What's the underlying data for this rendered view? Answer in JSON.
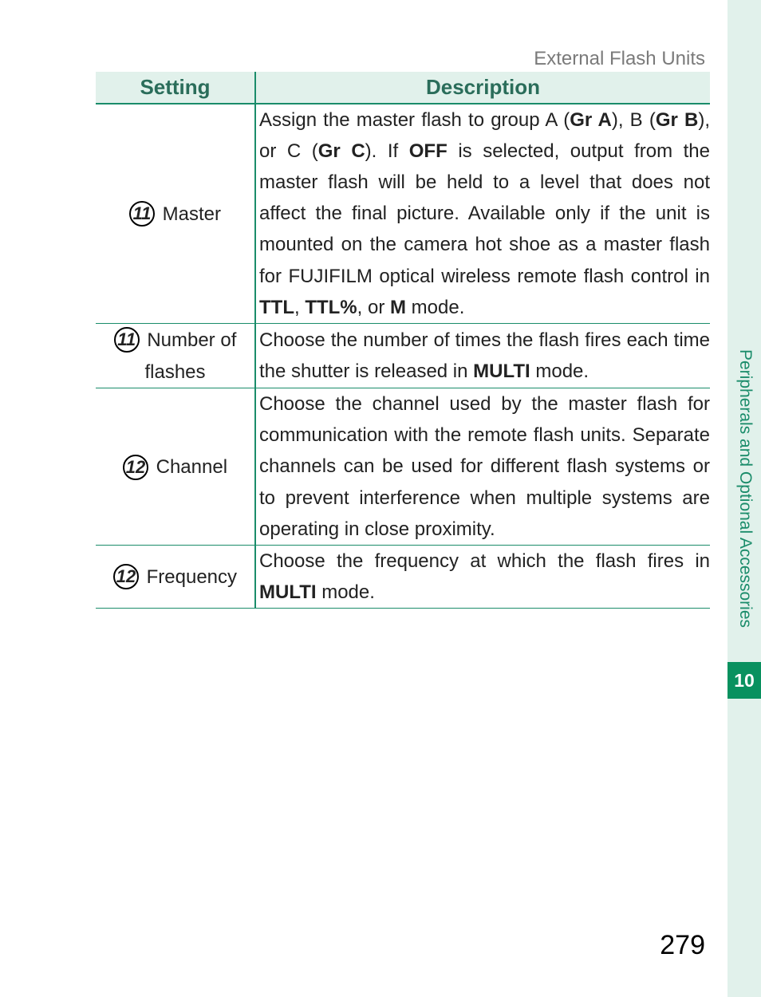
{
  "section_title": "External Flash Units",
  "headers": {
    "setting": "Setting",
    "description": "Description"
  },
  "rows": [
    {
      "num": "11",
      "label": "Master",
      "desc_html": "Assign the master flash to group A (<b>Gr A</b>), B (<b>Gr B</b>), or C (<b>Gr C</b>). If <b>OFF</b> is selected, output from the master flash will be held to a level that does not affect the final picture. Available only if the unit is mounted on the camera hot shoe as a master flash for FUJIFILM optical wireless remote flash control in <b>TTL</b>, <b>TTL%</b>, or <b>M</b> mode."
    },
    {
      "num": "11",
      "label": "Number of flashes",
      "desc_html": "Choose the number of times the flash fires each time the shutter is released in <b>MULTI</b> mode."
    },
    {
      "num": "12",
      "label": "Channel",
      "desc_html": "Choose the channel used by the master flash for communication with the remote flash units. Separate channels can be used for different flash systems or to prevent interference when multiple systems are operating in close proximity."
    },
    {
      "num": "12",
      "label": "Frequency",
      "desc_html": "Choose the frequency at which the flash fires in <b>MULTI</b> mode."
    }
  ],
  "side": {
    "label": "Peripherals and Optional Accessories",
    "chapter": "10"
  },
  "page_number": "279"
}
